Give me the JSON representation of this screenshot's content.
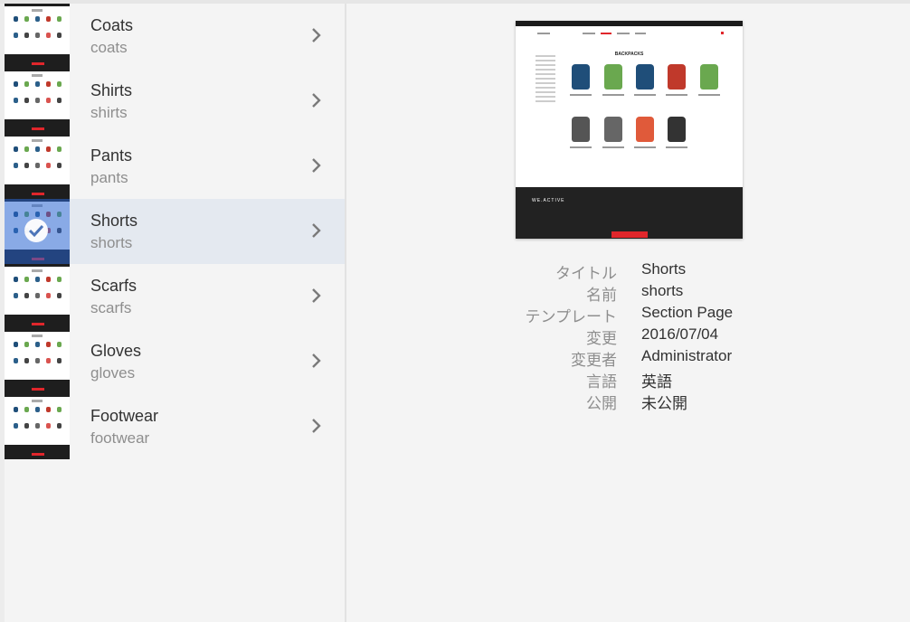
{
  "items": [
    {
      "title": "Coats",
      "name": "coats",
      "selected": false
    },
    {
      "title": "Shirts",
      "name": "shirts",
      "selected": false
    },
    {
      "title": "Pants",
      "name": "pants",
      "selected": false
    },
    {
      "title": "Shorts",
      "name": "shorts",
      "selected": true
    },
    {
      "title": "Scarfs",
      "name": "scarfs",
      "selected": false
    },
    {
      "title": "Gloves",
      "name": "gloves",
      "selected": false
    },
    {
      "title": "Footwear",
      "name": "footwear",
      "selected": false
    }
  ],
  "preview": {
    "heading": "BACKPACKS",
    "logo": "WE.ACTIVE"
  },
  "details": [
    {
      "key": "タイトル",
      "value": "Shorts"
    },
    {
      "key": "名前",
      "value": "shorts"
    },
    {
      "key": "テンプレート",
      "value": "Section Page"
    },
    {
      "key": "変更",
      "value": "2016/07/04"
    },
    {
      "key": "変更者",
      "value": "Administrator"
    },
    {
      "key": "言語",
      "value": "英語"
    },
    {
      "key": "公開",
      "value": "未公開"
    }
  ],
  "colors": {
    "selected_bg": "#e4e9f0",
    "overlay": "#2864d2",
    "accent_red": "#e0262b",
    "text_primary": "#323232",
    "text_secondary": "#8e8e8e"
  },
  "icons": {
    "chevron": "chevron-right-icon",
    "check": "check-circle-icon"
  }
}
